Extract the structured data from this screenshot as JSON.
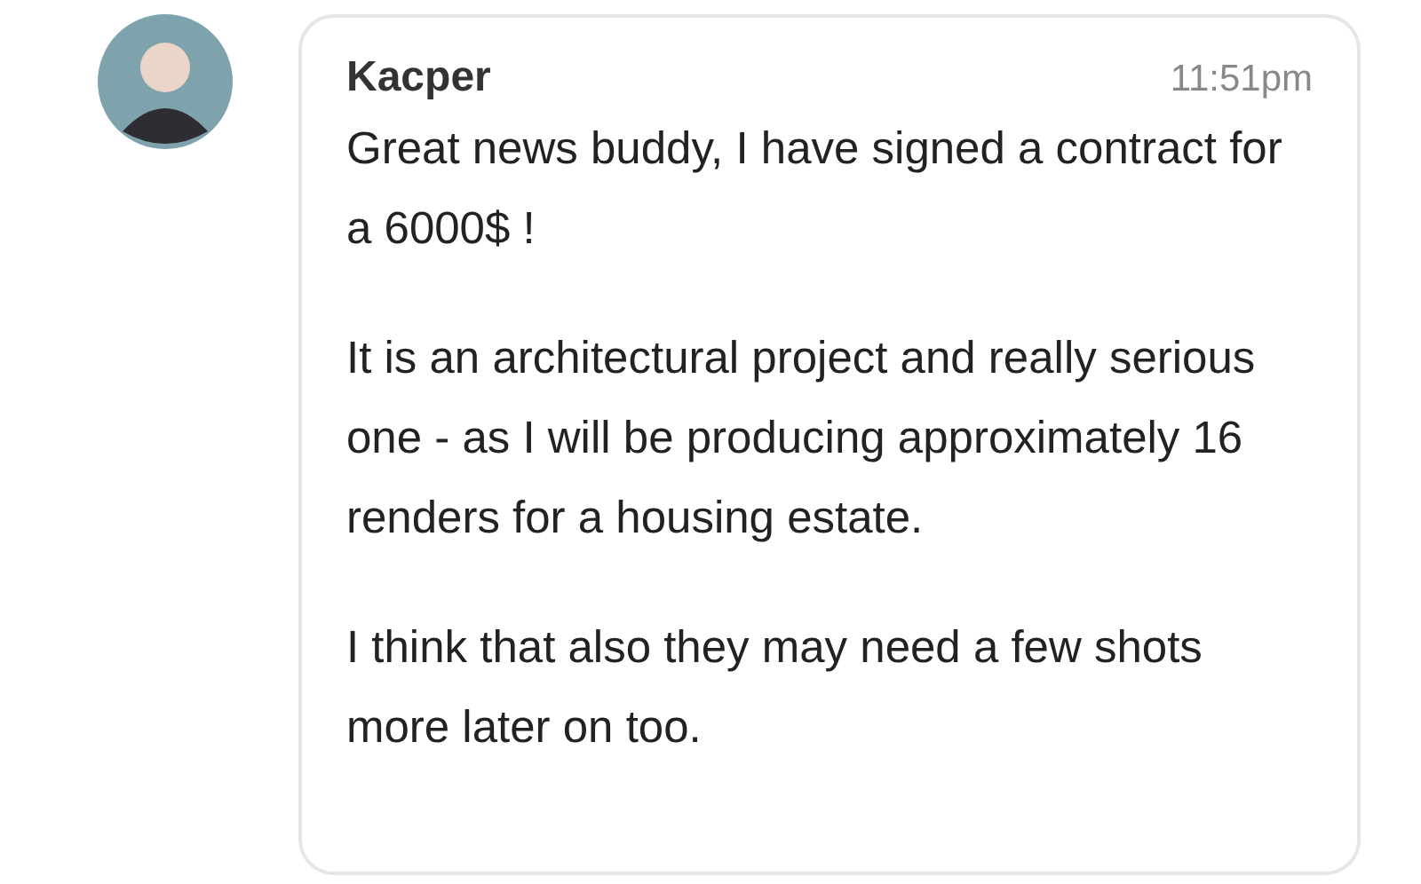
{
  "message": {
    "author": "Kacper",
    "time": "11:51pm",
    "paragraphs": [
      "Great news buddy, I have signed a contract for a 6000$ !",
      "It is an architectural project and really serious one - as I will be producing approximately 16 renders for a housing estate.",
      "I think that also they may need a few shots more later on too."
    ]
  }
}
